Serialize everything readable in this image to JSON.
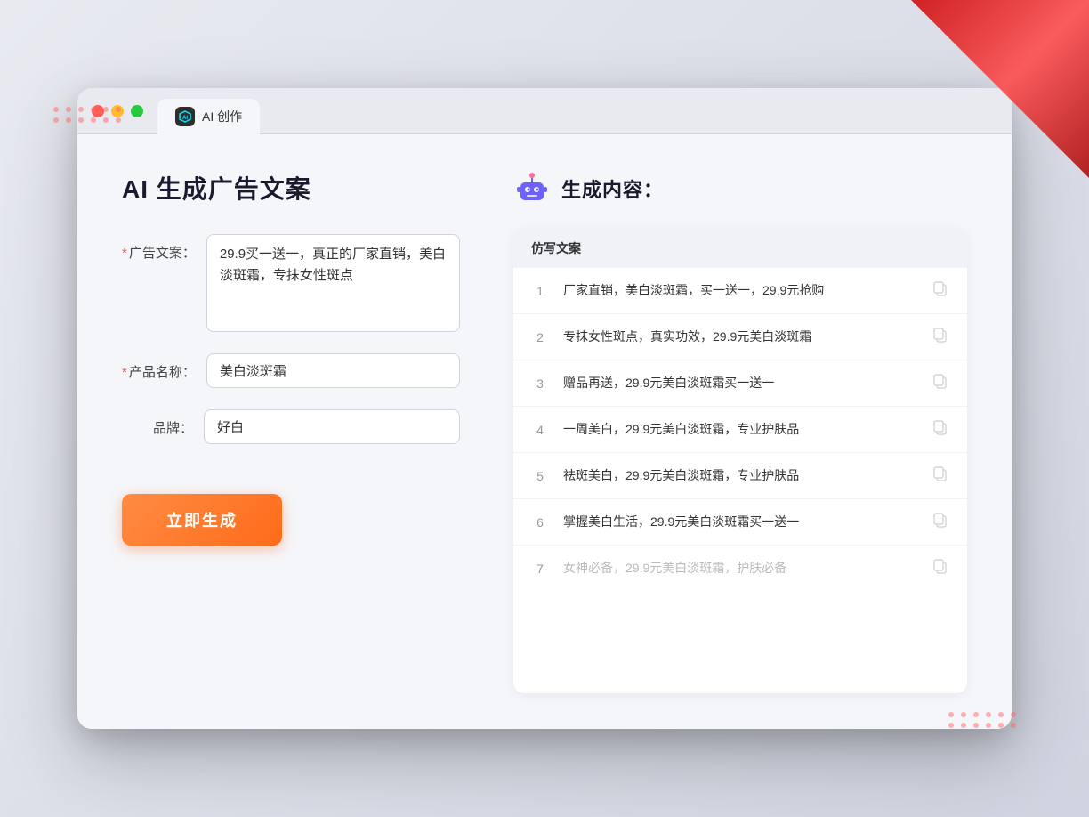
{
  "window": {
    "tab_icon": "AI",
    "tab_label": "AI 创作"
  },
  "left": {
    "page_title": "AI 生成广告文案",
    "form": {
      "ad_copy_label": "广告文案：",
      "ad_copy_required": "*",
      "ad_copy_value": "29.9买一送一，真正的厂家直销，美白淡斑霜，专抹女性斑点",
      "product_name_label": "产品名称：",
      "product_name_required": "*",
      "product_name_value": "美白淡斑霜",
      "brand_label": "品牌：",
      "brand_value": "好白"
    },
    "generate_button": "立即生成"
  },
  "right": {
    "header_title": "生成内容：",
    "table_header": "仿写文案",
    "results": [
      {
        "num": "1",
        "text": "厂家直销，美白淡斑霜，买一送一，29.9元抢购",
        "dimmed": false
      },
      {
        "num": "2",
        "text": "专抹女性斑点，真实功效，29.9元美白淡斑霜",
        "dimmed": false
      },
      {
        "num": "3",
        "text": "赠品再送，29.9元美白淡斑霜买一送一",
        "dimmed": false
      },
      {
        "num": "4",
        "text": "一周美白，29.9元美白淡斑霜，专业护肤品",
        "dimmed": false
      },
      {
        "num": "5",
        "text": "祛斑美白，29.9元美白淡斑霜，专业护肤品",
        "dimmed": false
      },
      {
        "num": "6",
        "text": "掌握美白生活，29.9元美白淡斑霜买一送一",
        "dimmed": false
      },
      {
        "num": "7",
        "text": "女神必备，29.9元美白淡斑霜，护肤必备",
        "dimmed": true
      }
    ]
  }
}
